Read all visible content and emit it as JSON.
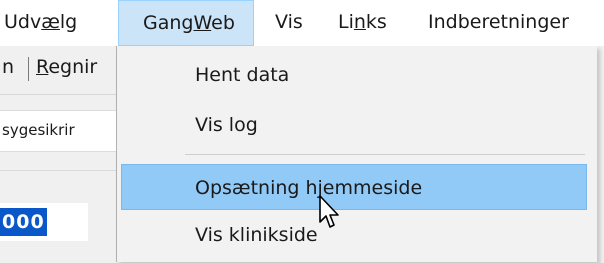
{
  "menubar": {
    "items": [
      {
        "label_pre": "Udv",
        "label_u": "æ",
        "label_post": "lg"
      },
      {
        "label_pre": "Gang",
        "label_u": "W",
        "label_post": "eb"
      },
      {
        "label_pre": "Vis",
        "label_u": "",
        "label_post": ""
      },
      {
        "label_pre": "Li",
        "label_u": "n",
        "label_post": "ks"
      },
      {
        "label_pre": "Indberetninger",
        "label_u": "",
        "label_post": ""
      }
    ]
  },
  "background": {
    "toolbar_frag_left": "n",
    "toolbar_frag_right_u": "R",
    "toolbar_frag_right": "egnir",
    "row2_text": "sygesikrir",
    "field_value": "000"
  },
  "dropdown": {
    "items": [
      {
        "label": "Hent data",
        "highlighted": false
      },
      {
        "label": "Vis log",
        "highlighted": false
      },
      {
        "label": "Opsætning hjemmeside",
        "highlighted": true
      },
      {
        "label": "Vis klinikside",
        "highlighted": false
      }
    ]
  },
  "colors": {
    "menu_open_bg": "#cce4f7",
    "highlight_bg": "#91c9f7",
    "selection_bg": "#0a57c9"
  }
}
